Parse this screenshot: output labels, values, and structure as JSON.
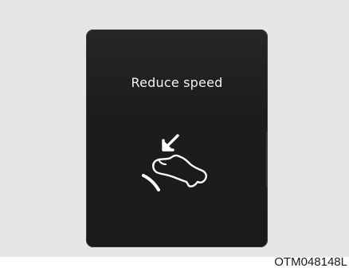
{
  "display": {
    "message": "Reduce speed",
    "icon": "accelerator-release-icon"
  },
  "figure": {
    "code": "OTM048148L"
  },
  "colors": {
    "display_background": "#1c1c1c",
    "panel_background": "#e6e6e6",
    "text": "#f2f2f2"
  }
}
